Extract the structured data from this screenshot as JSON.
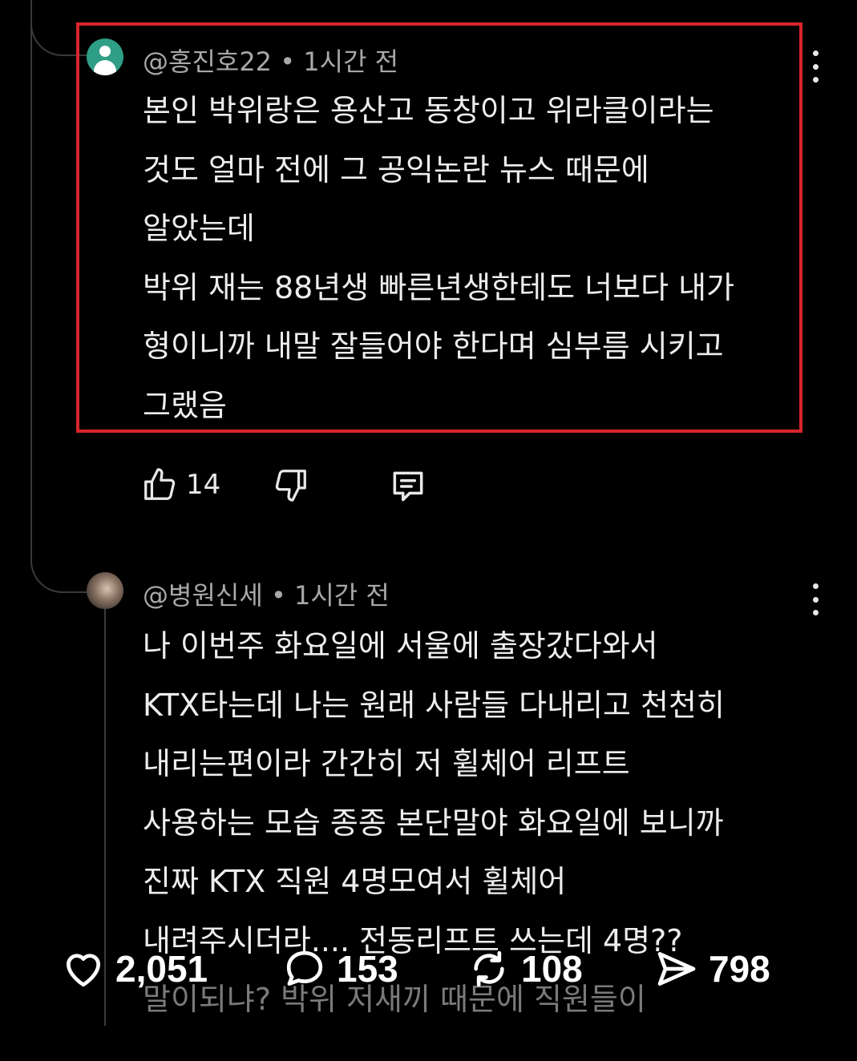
{
  "comments": [
    {
      "handle": "@홍진호22",
      "time": "1시간 전",
      "lines": [
        "본인 박위랑은 용산고 동창이고 위라클이라는",
        "것도 얼마 전에 그 공익논란 뉴스 때문에",
        "알았는데",
        "박위 재는 88년생 빠른년생한테도 너보다 내가",
        "형이니까 내말 잘들어야 한다며 심부름 시키고",
        "그랬음"
      ],
      "likes": "14",
      "highlighted": true,
      "highlight_color": "#d8262c"
    },
    {
      "handle": "@병원신세",
      "time": "1시간 전",
      "lines": [
        "나 이번주 화요일에 서울에 출장갔다와서",
        "KTX타는데 나는 원래 사람들 다내리고 천천히",
        "내리는편이라 간간히 저 휠체어 리프트",
        "사용하는 모습 종종 본단말야 화요일에 보니까",
        "진짜 KTX 직원 4명모여서 휠체어",
        "내려주시더라.... 전동리프트 쓰는데 4명??",
        "말이되냐? 박위 저새끼 때문에  직원들이"
      ]
    }
  ],
  "meta_separator": " • ",
  "post_stats": {
    "likes": "2,051",
    "comments": "153",
    "reposts": "108",
    "shares": "798"
  },
  "icons": {
    "avatar1": "default-person-avatar",
    "avatar2": "photo-avatar",
    "like": "thumbs-up-icon",
    "dislike": "thumbs-down-icon",
    "reply": "reply-comment-icon",
    "more": "more-vertical-icon",
    "heart": "heart-icon",
    "comment": "speech-bubble-icon",
    "repost": "repost-icon",
    "share": "send-icon"
  },
  "colors": {
    "background": "#000000",
    "text": "#ededed",
    "meta": "#a8a8a8"
  }
}
